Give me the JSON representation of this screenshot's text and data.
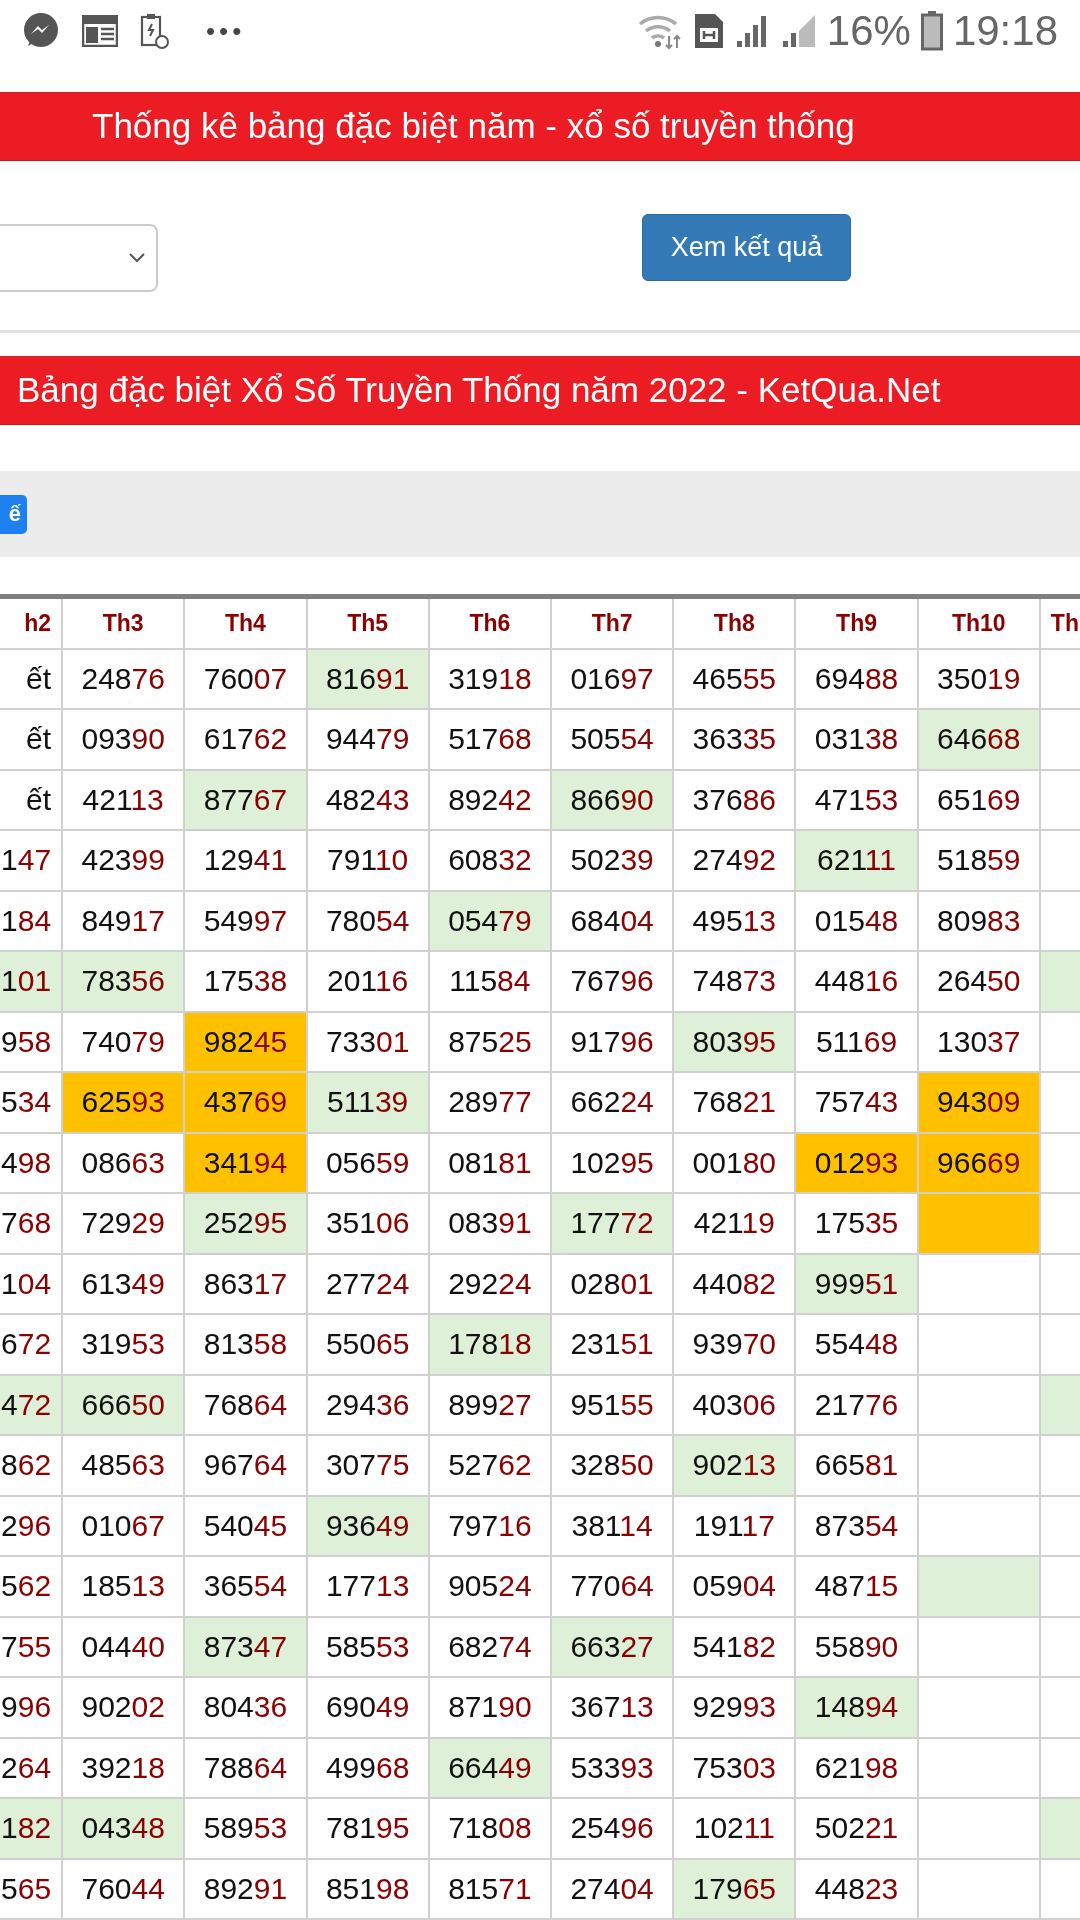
{
  "status_bar": {
    "overflow": "•••",
    "battery": "16%",
    "time": "19:18"
  },
  "title_bar": {
    "title": "Thống kê bảng đặc biệt năm - xổ số truyền thống"
  },
  "filter": {
    "submit_button": "Xem kết quả"
  },
  "table_title": {
    "title": "Bảng đặc biệt Xổ Số Truyền Thống năm 2022 - KetQua.Net"
  },
  "toolbar": {
    "button": "ế"
  },
  "table": {
    "columns": [
      "h2",
      "Th3",
      "Th4",
      "Th5",
      "Th6",
      "Th7",
      "Th8",
      "Th9",
      "Th10",
      "Th"
    ],
    "rows": [
      {
        "cells": [
          {
            "text": "ết",
            "kind": "label"
          },
          {
            "text": "24876",
            "kind": "number"
          },
          {
            "text": "76007",
            "kind": "number"
          },
          {
            "text": "81691",
            "kind": "number",
            "color": "#dff0d8"
          },
          {
            "text": "31918",
            "kind": "number"
          },
          {
            "text": "01697",
            "kind": "number"
          },
          {
            "text": "46555",
            "kind": "number"
          },
          {
            "text": "69488",
            "kind": "number"
          },
          {
            "text": "35019",
            "kind": "number"
          },
          {
            "kind": "empty"
          }
        ]
      },
      {
        "cells": [
          {
            "text": "ết",
            "kind": "label"
          },
          {
            "text": "09390",
            "kind": "number"
          },
          {
            "text": "61762",
            "kind": "number"
          },
          {
            "text": "94479",
            "kind": "number"
          },
          {
            "text": "51768",
            "kind": "number"
          },
          {
            "text": "50554",
            "kind": "number"
          },
          {
            "text": "36335",
            "kind": "number"
          },
          {
            "text": "03138",
            "kind": "number"
          },
          {
            "text": "64668",
            "kind": "number",
            "color": "#dff0d8"
          },
          {
            "kind": "empty"
          }
        ]
      },
      {
        "cells": [
          {
            "text": "ết",
            "kind": "label"
          },
          {
            "text": "42113",
            "kind": "number"
          },
          {
            "text": "87767",
            "kind": "number",
            "color": "#dff0d8"
          },
          {
            "text": "48243",
            "kind": "number"
          },
          {
            "text": "89242",
            "kind": "number"
          },
          {
            "text": "86690",
            "kind": "number",
            "color": "#dff0d8"
          },
          {
            "text": "37686",
            "kind": "number"
          },
          {
            "text": "47153",
            "kind": "number"
          },
          {
            "text": "65169",
            "kind": "number"
          },
          {
            "kind": "empty"
          }
        ]
      },
      {
        "cells": [
          {
            "text": "147",
            "kind": "number"
          },
          {
            "text": "42399",
            "kind": "number"
          },
          {
            "text": "12941",
            "kind": "number"
          },
          {
            "text": "79110",
            "kind": "number"
          },
          {
            "text": "60832",
            "kind": "number"
          },
          {
            "text": "50239",
            "kind": "number"
          },
          {
            "text": "27492",
            "kind": "number"
          },
          {
            "text": "62111",
            "kind": "number",
            "color": "#dff0d8"
          },
          {
            "text": "51859",
            "kind": "number"
          },
          {
            "kind": "empty"
          }
        ]
      },
      {
        "cells": [
          {
            "text": "184",
            "kind": "number"
          },
          {
            "text": "84917",
            "kind": "number"
          },
          {
            "text": "54997",
            "kind": "number"
          },
          {
            "text": "78054",
            "kind": "number"
          },
          {
            "text": "05479",
            "kind": "number",
            "color": "#dff0d8"
          },
          {
            "text": "68404",
            "kind": "number"
          },
          {
            "text": "49513",
            "kind": "number"
          },
          {
            "text": "01548",
            "kind": "number"
          },
          {
            "text": "80983",
            "kind": "number"
          },
          {
            "kind": "empty"
          }
        ]
      },
      {
        "cells": [
          {
            "text": "101",
            "kind": "number",
            "color": "#dff0d8"
          },
          {
            "text": "78356",
            "kind": "number",
            "color": "#dff0d8"
          },
          {
            "text": "17538",
            "kind": "number"
          },
          {
            "text": "20116",
            "kind": "number"
          },
          {
            "text": "11584",
            "kind": "number"
          },
          {
            "text": "76796",
            "kind": "number"
          },
          {
            "text": "74873",
            "kind": "number"
          },
          {
            "text": "44816",
            "kind": "number"
          },
          {
            "text": "26450",
            "kind": "number"
          },
          {
            "kind": "empty",
            "color": "#dff0d8"
          }
        ]
      },
      {
        "cells": [
          {
            "text": "958",
            "kind": "number"
          },
          {
            "text": "74079",
            "kind": "number"
          },
          {
            "text": "98245",
            "kind": "number",
            "color": "#ffc000"
          },
          {
            "text": "73301",
            "kind": "number"
          },
          {
            "text": "87525",
            "kind": "number"
          },
          {
            "text": "91796",
            "kind": "number"
          },
          {
            "text": "80395",
            "kind": "number",
            "color": "#dff0d8"
          },
          {
            "text": "51169",
            "kind": "number"
          },
          {
            "text": "13037",
            "kind": "number"
          },
          {
            "kind": "empty"
          }
        ]
      },
      {
        "cells": [
          {
            "text": "534",
            "kind": "number"
          },
          {
            "text": "62593",
            "kind": "number",
            "color": "#ffc000"
          },
          {
            "text": "43769",
            "kind": "number",
            "color": "#ffc000"
          },
          {
            "text": "51139",
            "kind": "number",
            "color": "#dff0d8"
          },
          {
            "text": "28977",
            "kind": "number"
          },
          {
            "text": "66224",
            "kind": "number"
          },
          {
            "text": "76821",
            "kind": "number"
          },
          {
            "text": "75743",
            "kind": "number"
          },
          {
            "text": "94309",
            "kind": "number",
            "color": "#ffc000"
          },
          {
            "kind": "empty"
          }
        ]
      },
      {
        "cells": [
          {
            "text": "498",
            "kind": "number"
          },
          {
            "text": "08663",
            "kind": "number"
          },
          {
            "text": "34194",
            "kind": "number",
            "color": "#ffc000"
          },
          {
            "text": "05659",
            "kind": "number"
          },
          {
            "text": "08181",
            "kind": "number"
          },
          {
            "text": "10295",
            "kind": "number"
          },
          {
            "text": "00180",
            "kind": "number"
          },
          {
            "text": "01293",
            "kind": "number",
            "color": "#ffc000"
          },
          {
            "text": "96669",
            "kind": "number",
            "color": "#ffc000"
          },
          {
            "kind": "empty"
          }
        ]
      },
      {
        "cells": [
          {
            "text": "768",
            "kind": "number"
          },
          {
            "text": "72929",
            "kind": "number"
          },
          {
            "text": "25295",
            "kind": "number",
            "color": "#dff0d8"
          },
          {
            "text": "35106",
            "kind": "number"
          },
          {
            "text": "08391",
            "kind": "number"
          },
          {
            "text": "17772",
            "kind": "number",
            "color": "#dff0d8"
          },
          {
            "text": "42119",
            "kind": "number"
          },
          {
            "text": "17535",
            "kind": "number"
          },
          {
            "kind": "empty",
            "color": "#ffc000"
          },
          {
            "kind": "empty"
          }
        ]
      },
      {
        "cells": [
          {
            "text": "104",
            "kind": "number"
          },
          {
            "text": "61349",
            "kind": "number"
          },
          {
            "text": "86317",
            "kind": "number"
          },
          {
            "text": "27724",
            "kind": "number"
          },
          {
            "text": "29224",
            "kind": "number"
          },
          {
            "text": "02801",
            "kind": "number"
          },
          {
            "text": "44082",
            "kind": "number"
          },
          {
            "text": "99951",
            "kind": "number",
            "color": "#dff0d8"
          },
          {
            "kind": "empty"
          },
          {
            "kind": "empty"
          }
        ]
      },
      {
        "cells": [
          {
            "text": "672",
            "kind": "number"
          },
          {
            "text": "31953",
            "kind": "number"
          },
          {
            "text": "81358",
            "kind": "number"
          },
          {
            "text": "55065",
            "kind": "number"
          },
          {
            "text": "17818",
            "kind": "number",
            "color": "#dff0d8"
          },
          {
            "text": "23151",
            "kind": "number"
          },
          {
            "text": "93970",
            "kind": "number"
          },
          {
            "text": "55448",
            "kind": "number"
          },
          {
            "kind": "empty"
          },
          {
            "kind": "empty"
          }
        ]
      },
      {
        "cells": [
          {
            "text": "472",
            "kind": "number",
            "color": "#dff0d8"
          },
          {
            "text": "66650",
            "kind": "number",
            "color": "#dff0d8"
          },
          {
            "text": "76864",
            "kind": "number"
          },
          {
            "text": "29436",
            "kind": "number"
          },
          {
            "text": "89927",
            "kind": "number"
          },
          {
            "text": "95155",
            "kind": "number"
          },
          {
            "text": "40306",
            "kind": "number"
          },
          {
            "text": "21776",
            "kind": "number"
          },
          {
            "kind": "empty"
          },
          {
            "kind": "empty",
            "color": "#dff0d8"
          }
        ]
      },
      {
        "cells": [
          {
            "text": "862",
            "kind": "number"
          },
          {
            "text": "48563",
            "kind": "number"
          },
          {
            "text": "96764",
            "kind": "number"
          },
          {
            "text": "30775",
            "kind": "number"
          },
          {
            "text": "52762",
            "kind": "number"
          },
          {
            "text": "32850",
            "kind": "number"
          },
          {
            "text": "90213",
            "kind": "number",
            "color": "#dff0d8"
          },
          {
            "text": "66581",
            "kind": "number"
          },
          {
            "kind": "empty"
          },
          {
            "kind": "empty"
          }
        ]
      },
      {
        "cells": [
          {
            "text": "296",
            "kind": "number"
          },
          {
            "text": "01067",
            "kind": "number"
          },
          {
            "text": "54045",
            "kind": "number"
          },
          {
            "text": "93649",
            "kind": "number",
            "color": "#dff0d8"
          },
          {
            "text": "79716",
            "kind": "number"
          },
          {
            "text": "38114",
            "kind": "number"
          },
          {
            "text": "19117",
            "kind": "number"
          },
          {
            "text": "87354",
            "kind": "number"
          },
          {
            "kind": "empty"
          },
          {
            "kind": "empty"
          }
        ]
      },
      {
        "cells": [
          {
            "text": "562",
            "kind": "number"
          },
          {
            "text": "18513",
            "kind": "number"
          },
          {
            "text": "36554",
            "kind": "number"
          },
          {
            "text": "17713",
            "kind": "number"
          },
          {
            "text": "90524",
            "kind": "number"
          },
          {
            "text": "77064",
            "kind": "number"
          },
          {
            "text": "05904",
            "kind": "number"
          },
          {
            "text": "48715",
            "kind": "number"
          },
          {
            "kind": "empty",
            "color": "#dff0d8"
          },
          {
            "kind": "empty"
          }
        ]
      },
      {
        "cells": [
          {
            "text": "755",
            "kind": "number"
          },
          {
            "text": "04440",
            "kind": "number"
          },
          {
            "text": "87347",
            "kind": "number",
            "color": "#dff0d8"
          },
          {
            "text": "58553",
            "kind": "number"
          },
          {
            "text": "68274",
            "kind": "number"
          },
          {
            "text": "66327",
            "kind": "number",
            "color": "#dff0d8"
          },
          {
            "text": "54182",
            "kind": "number"
          },
          {
            "text": "55890",
            "kind": "number"
          },
          {
            "kind": "empty"
          },
          {
            "kind": "empty"
          }
        ]
      },
      {
        "cells": [
          {
            "text": "996",
            "kind": "number"
          },
          {
            "text": "90202",
            "kind": "number"
          },
          {
            "text": "80436",
            "kind": "number"
          },
          {
            "text": "69049",
            "kind": "number"
          },
          {
            "text": "87190",
            "kind": "number"
          },
          {
            "text": "36713",
            "kind": "number"
          },
          {
            "text": "92993",
            "kind": "number"
          },
          {
            "text": "14894",
            "kind": "number",
            "color": "#dff0d8"
          },
          {
            "kind": "empty"
          },
          {
            "kind": "empty"
          }
        ]
      },
      {
        "cells": [
          {
            "text": "264",
            "kind": "number"
          },
          {
            "text": "39218",
            "kind": "number"
          },
          {
            "text": "78864",
            "kind": "number"
          },
          {
            "text": "49968",
            "kind": "number"
          },
          {
            "text": "66449",
            "kind": "number",
            "color": "#dff0d8"
          },
          {
            "text": "53393",
            "kind": "number"
          },
          {
            "text": "75303",
            "kind": "number"
          },
          {
            "text": "62198",
            "kind": "number"
          },
          {
            "kind": "empty"
          },
          {
            "kind": "empty"
          }
        ]
      },
      {
        "cells": [
          {
            "text": "182",
            "kind": "number",
            "color": "#dff0d8"
          },
          {
            "text": "04348",
            "kind": "number",
            "color": "#dff0d8"
          },
          {
            "text": "58953",
            "kind": "number"
          },
          {
            "text": "78195",
            "kind": "number"
          },
          {
            "text": "71808",
            "kind": "number"
          },
          {
            "text": "25496",
            "kind": "number"
          },
          {
            "text": "10211",
            "kind": "number"
          },
          {
            "text": "50221",
            "kind": "number"
          },
          {
            "kind": "empty"
          },
          {
            "kind": "empty",
            "color": "#dff0d8"
          }
        ]
      },
      {
        "cells": [
          {
            "text": "565",
            "kind": "number"
          },
          {
            "text": "76044",
            "kind": "number"
          },
          {
            "text": "89291",
            "kind": "number"
          },
          {
            "text": "85198",
            "kind": "number"
          },
          {
            "text": "81571",
            "kind": "number"
          },
          {
            "text": "27404",
            "kind": "number"
          },
          {
            "text": "17965",
            "kind": "number",
            "color": "#dff0d8"
          },
          {
            "text": "44823",
            "kind": "number"
          },
          {
            "kind": "empty"
          },
          {
            "kind": "empty"
          }
        ]
      }
    ]
  }
}
